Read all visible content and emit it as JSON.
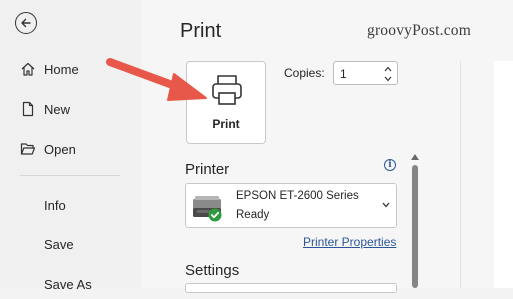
{
  "sidebar": {
    "back_icon": "back-arrow-icon",
    "items": [
      {
        "label": "Home",
        "icon": "home-icon"
      },
      {
        "label": "New",
        "icon": "new-document-icon"
      },
      {
        "label": "Open",
        "icon": "folder-open-icon"
      },
      {
        "label": "Info"
      },
      {
        "label": "Save"
      },
      {
        "label": "Save As"
      }
    ]
  },
  "main": {
    "title": "Print",
    "print_button": {
      "label": "Print",
      "icon": "printer-icon"
    },
    "copies": {
      "label": "Copies:",
      "value": "1"
    },
    "printer_section": {
      "heading": "Printer",
      "info_icon": "info-icon",
      "selected_name": "EPSON ET-2600 Series",
      "selected_status": "Ready",
      "properties_link": "Printer Properties"
    },
    "settings_section": {
      "heading": "Settings"
    }
  },
  "watermark": "groovyPost.com",
  "annotation": {
    "type": "red-arrow",
    "color": "#e8584a"
  },
  "colors": {
    "accent": "#2b5797",
    "arrow": "#e8584a",
    "check": "#2e9a3e"
  }
}
